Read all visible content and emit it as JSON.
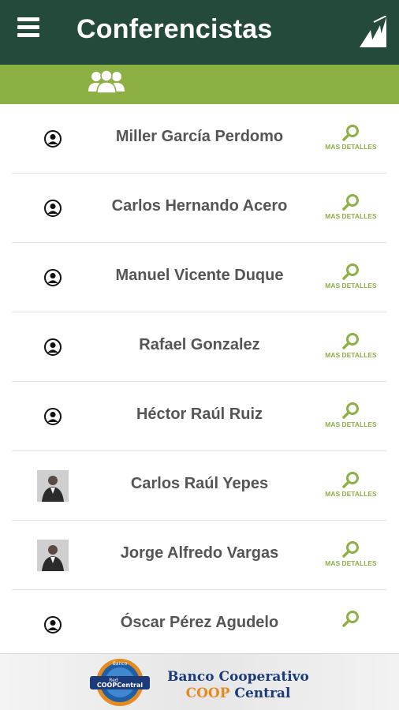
{
  "app": {
    "title": "Conferencistas"
  },
  "icons": {
    "menu": "hamburger-menu-icon",
    "brand": "brand-logo-icon",
    "speakers_tab": "people-group-icon",
    "avatar_placeholder": "person-silhouette-icon",
    "details": "magnifier-icon"
  },
  "colors": {
    "appbar": "#244a3b",
    "tabbar": "#8cb043",
    "accent": "#8cb043",
    "name_text": "#555555"
  },
  "speakers": [
    {
      "name": "Miller García Perdomo",
      "details_label": "MAS DETALLES",
      "has_photo": false
    },
    {
      "name": "Carlos Hernando Acero",
      "details_label": "MAS DETALLES",
      "has_photo": false
    },
    {
      "name": "Manuel Vicente Duque",
      "details_label": "MAS DETALLES",
      "has_photo": false
    },
    {
      "name": "Rafael Gonzalez",
      "details_label": "MAS DETALLES",
      "has_photo": false
    },
    {
      "name": "Héctor Raúl Ruiz",
      "details_label": "MAS DETALLES",
      "has_photo": false
    },
    {
      "name": "Carlos Raúl Yepes",
      "details_label": "MAS DETALLES",
      "has_photo": true
    },
    {
      "name": "Jorge Alfredo Vargas",
      "details_label": "MAS DETALLES",
      "has_photo": true
    },
    {
      "name": "Óscar Pérez Agudelo",
      "details_label": "",
      "has_photo": false
    }
  ],
  "footer": {
    "bank_line1": "Banco Cooperativo",
    "bank_line2_a": "COOP",
    "bank_line2_b": "Central",
    "logo_badge_top": "Banco",
    "logo_badge_mid": "Red",
    "logo_badge_main": "COOPCentral"
  }
}
